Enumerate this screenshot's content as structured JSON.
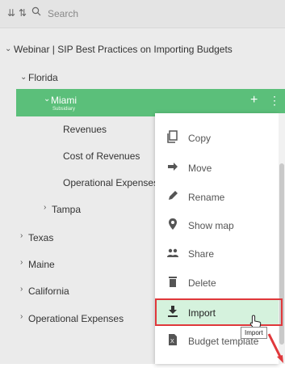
{
  "search": {
    "placeholder": "Search"
  },
  "tree": {
    "root": {
      "label": "Webinar | SIP Best Practices on Importing Budgets"
    },
    "florida": {
      "label": "Florida"
    },
    "miami": {
      "label": "Miami",
      "sublabel": "Subsidiary"
    },
    "miami_children": [
      {
        "label": "Revenues"
      },
      {
        "label": "Cost of Revenues"
      },
      {
        "label": "Operational Expenses"
      }
    ],
    "tampa": {
      "label": "Tampa"
    },
    "others": [
      {
        "label": "Texas"
      },
      {
        "label": "Maine"
      },
      {
        "label": "California"
      },
      {
        "label": "Operational Expenses"
      }
    ]
  },
  "selected_actions": {
    "add": "+",
    "more": "⋮"
  },
  "context_menu": {
    "items": [
      {
        "label": "Copy",
        "icon": "copy-icon"
      },
      {
        "label": "Move",
        "icon": "move-arrow-icon"
      },
      {
        "label": "Rename",
        "icon": "pencil-icon"
      },
      {
        "label": "Show map",
        "icon": "map-pin-icon"
      },
      {
        "label": "Share",
        "icon": "share-users-icon"
      },
      {
        "label": "Delete",
        "icon": "trash-icon"
      },
      {
        "label": "Import",
        "icon": "download-icon"
      },
      {
        "label": "Budget template",
        "icon": "excel-file-icon"
      }
    ]
  },
  "tooltip": {
    "text": "Import"
  },
  "colors": {
    "accent": "#5bbf7a",
    "highlight_bg": "#d5f2dd",
    "highlight_frame": "#e0383b"
  }
}
